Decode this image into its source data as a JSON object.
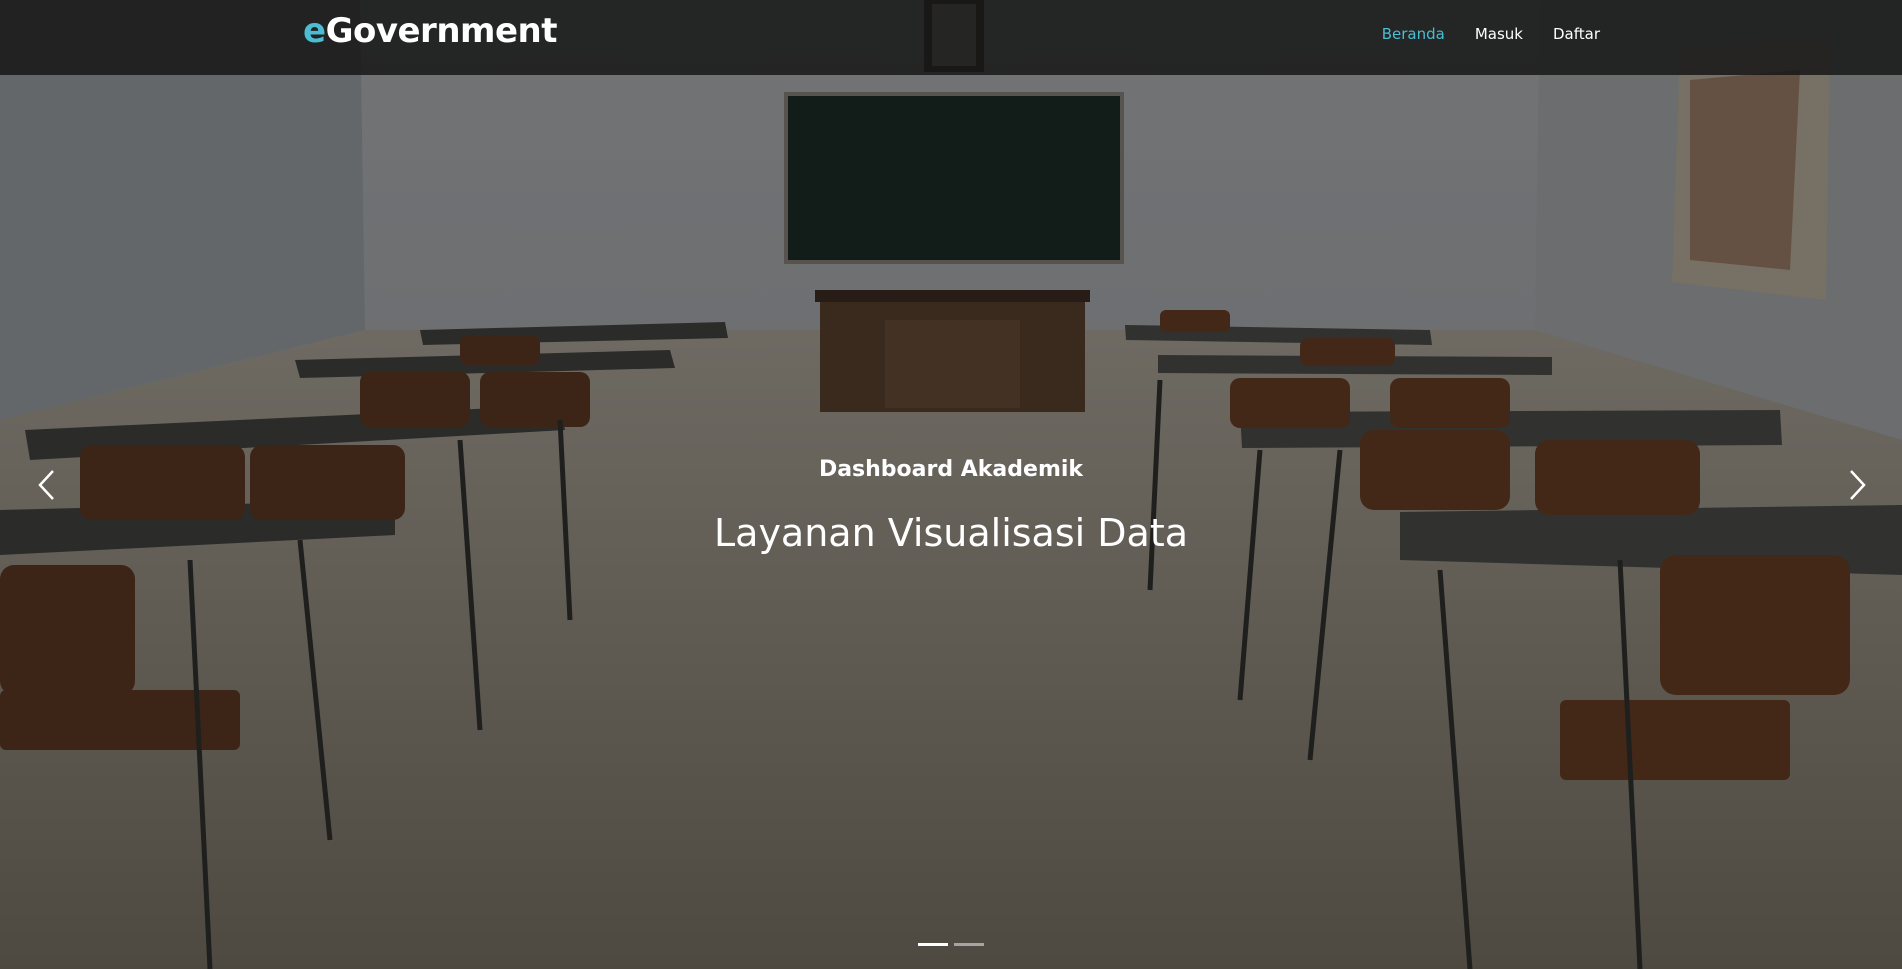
{
  "navbar": {
    "brand_prefix": "e",
    "brand_rest": "Government",
    "links": [
      {
        "label": "Beranda",
        "active": true
      },
      {
        "label": "Masuk",
        "active": false
      },
      {
        "label": "Daftar",
        "active": false
      }
    ]
  },
  "hero": {
    "subtitle": "Dashboard Akademik",
    "title": "Layanan Visualisasi Data",
    "background_image": "empty-classroom-photo",
    "prev_icon": "chevron-left-icon",
    "next_icon": "chevron-right-icon",
    "slide_count": 2,
    "active_slide": 1
  },
  "colors": {
    "accent": "#4bbcd2",
    "navbar_bg": "#141414",
    "text": "#ffffff"
  }
}
